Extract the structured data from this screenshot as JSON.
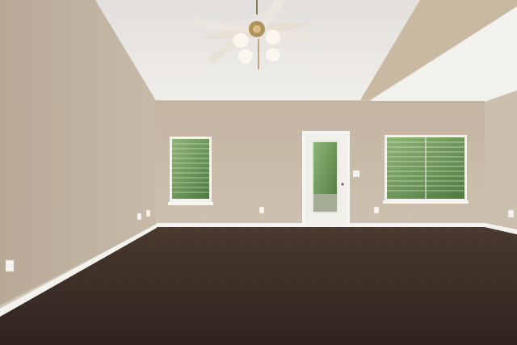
{
  "scene": {
    "subject": "empty-room-interior",
    "fixtures": [
      "ceiling-fan",
      "left-window",
      "glass-door",
      "right-window",
      "hardwood-floor"
    ]
  },
  "colors": {
    "wall_back": "#c6b8a5",
    "wall_left": "#bdb09e",
    "wall_right": "#cbbfae",
    "ceiling": "#e9e6e2",
    "floor": "#3a2c24",
    "trim": "#f4f2ee",
    "window_glass": "#6f9a59"
  }
}
